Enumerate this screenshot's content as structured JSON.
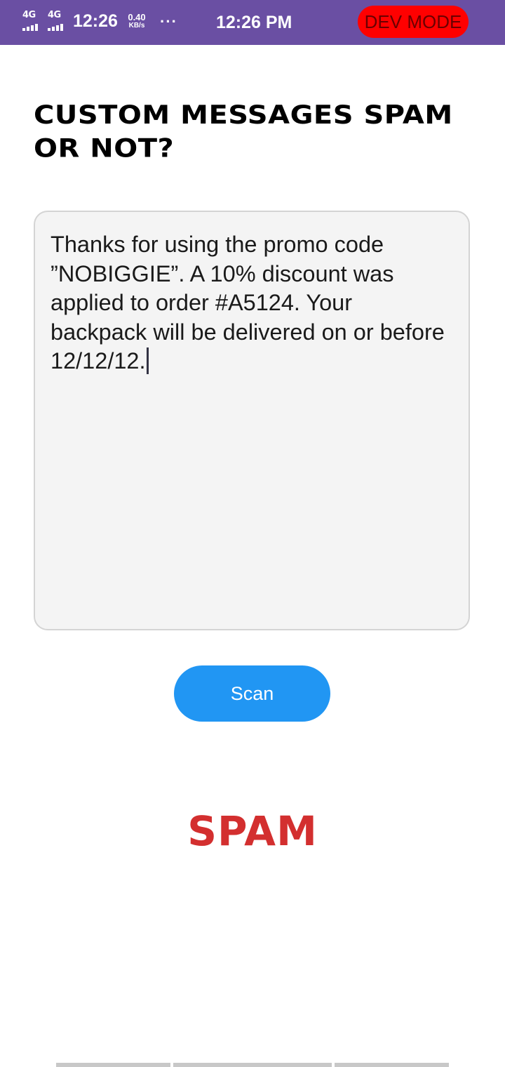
{
  "status_bar": {
    "network1": "4G",
    "network2": "4G",
    "time_left": "12:26",
    "speed_value": "0.40",
    "speed_unit": "KB/s",
    "more_indicator": "···",
    "time_center": "12:26 PM",
    "dev_mode": "DEV MODE",
    "dev_mode_color": "#ff0000",
    "background_color": "#6a4fa3"
  },
  "title": "Custom messages spam or not?",
  "message": {
    "text": "Thanks for using the promo code ”NOBIGGIE”. A 10% discount was applied to order #A5124. Your backpack will be delivered on or before 12/12/12."
  },
  "scan_button": {
    "label": "Scan",
    "color": "#2196f3"
  },
  "result": {
    "label": "SPAM",
    "color": "#d32f2f"
  }
}
